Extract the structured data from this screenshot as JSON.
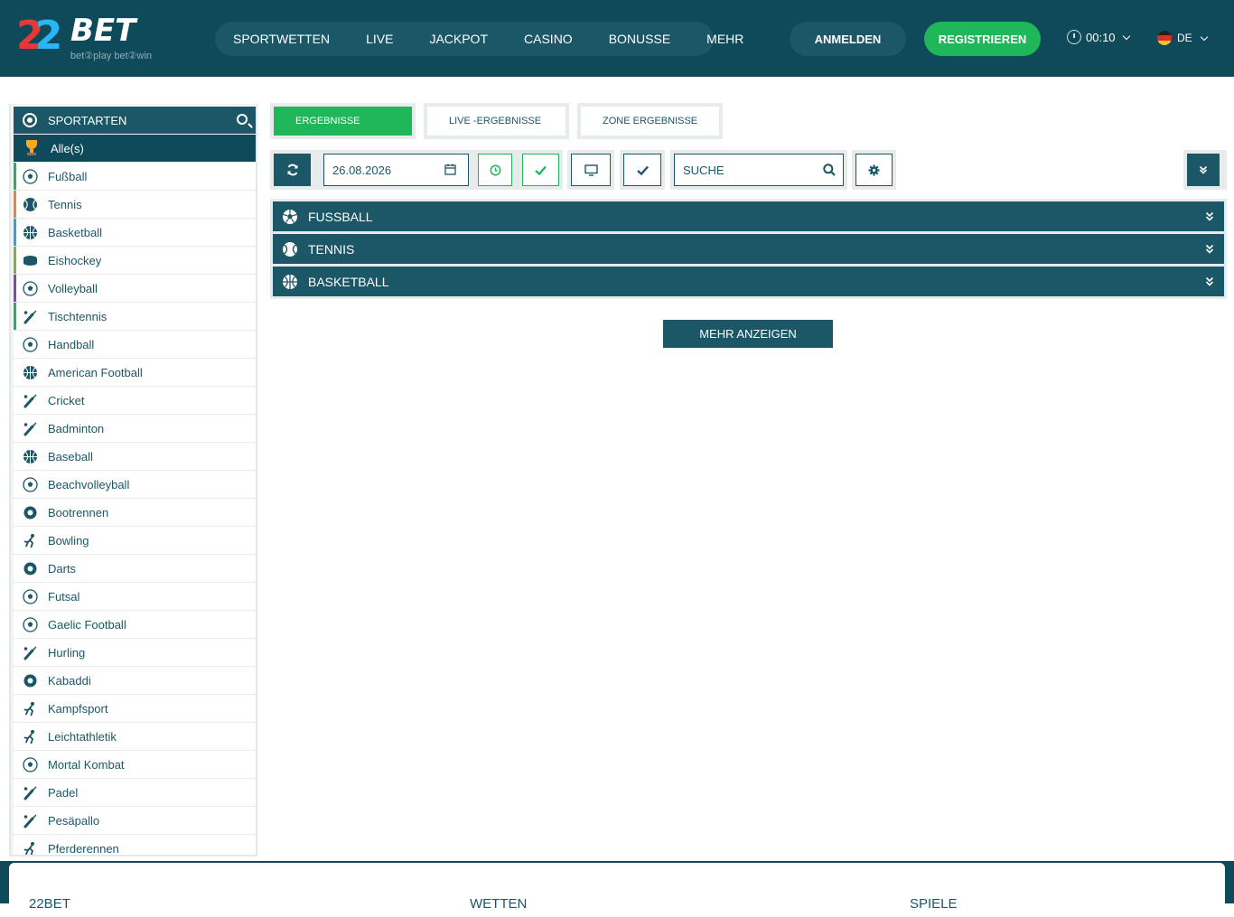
{
  "logo": {
    "brand_digits": "22",
    "brand_text": "BET",
    "tagline": "bet②play  bet②win"
  },
  "nav": {
    "items": [
      "SPORTWETTEN",
      "LIVE",
      "JACKPOT",
      "CASINO",
      "BONUSSE",
      "MEHR"
    ]
  },
  "header": {
    "login_label": "ANMELDEN",
    "register_label": "REGISTRIEREN",
    "time": "00:10",
    "language": "DE"
  },
  "sidebar": {
    "title": "SPORTARTEN",
    "all_label": "Alle(s)",
    "items": [
      {
        "label": "Fußball",
        "stripe": "#1fb759",
        "icon": "soccer-ball-icon"
      },
      {
        "label": "Tennis",
        "stripe": "#f0803c",
        "icon": "tennis-ball-icon"
      },
      {
        "label": "Basketball",
        "stripe": "#29a7d8",
        "icon": "basketball-icon"
      },
      {
        "label": "Eishockey",
        "stripe": "#7cb342",
        "icon": "hockey-puck-icon"
      },
      {
        "label": "Volleyball",
        "stripe": "#8e44ad",
        "icon": "volleyball-icon"
      },
      {
        "label": "Tischtennis",
        "stripe": "#1fb759",
        "icon": "table-tennis-icon"
      },
      {
        "label": "Handball",
        "stripe": "",
        "icon": "handball-icon"
      },
      {
        "label": "American Football",
        "stripe": "",
        "icon": "american-football-icon"
      },
      {
        "label": "Cricket",
        "stripe": "",
        "icon": "cricket-bat-icon"
      },
      {
        "label": "Badminton",
        "stripe": "",
        "icon": "shuttlecock-icon"
      },
      {
        "label": "Baseball",
        "stripe": "",
        "icon": "baseball-icon"
      },
      {
        "label": "Beachvolleyball",
        "stripe": "",
        "icon": "beach-volleyball-icon"
      },
      {
        "label": "Bootrennen",
        "stripe": "",
        "icon": "boat-icon"
      },
      {
        "label": "Bowling",
        "stripe": "",
        "icon": "bowling-icon"
      },
      {
        "label": "Darts",
        "stripe": "",
        "icon": "dartboard-icon"
      },
      {
        "label": "Futsal",
        "stripe": "",
        "icon": "futsal-ball-icon"
      },
      {
        "label": "Gaelic Football",
        "stripe": "",
        "icon": "gaelic-football-icon"
      },
      {
        "label": "Hurling",
        "stripe": "",
        "icon": "hurling-sticks-icon"
      },
      {
        "label": "Kabaddi",
        "stripe": "",
        "icon": "kabaddi-court-icon"
      },
      {
        "label": "Kampfsport",
        "stripe": "",
        "icon": "martial-arts-icon"
      },
      {
        "label": "Leichtathletik",
        "stripe": "",
        "icon": "runner-icon"
      },
      {
        "label": "Mortal Kombat",
        "stripe": "",
        "icon": "mortal-kombat-icon"
      },
      {
        "label": "Padel",
        "stripe": "",
        "icon": "padel-racket-icon"
      },
      {
        "label": "Pesäpallo",
        "stripe": "",
        "icon": "pesapallo-bat-icon"
      },
      {
        "label": "Pferderennen",
        "stripe": "",
        "icon": "horse-racing-icon"
      }
    ]
  },
  "tabs": [
    "ERGEBNISSE",
    "LIVE -ERGEBNISSE",
    "ZONE ERGEBNISSE"
  ],
  "toolbar": {
    "date": "26.08.2026",
    "search_placeholder": "SUCHE"
  },
  "results": [
    {
      "label": "FUSSBALL",
      "icon": "soccer-ball-icon"
    },
    {
      "label": "TENNIS",
      "icon": "tennis-ball-icon"
    },
    {
      "label": "BASKETBALL",
      "icon": "basketball-icon"
    }
  ],
  "more_label": "MEHR ANZEIGEN",
  "footer": {
    "columns": [
      "22BET",
      "WETTEN",
      "SPIELE"
    ]
  },
  "colors": {
    "primary": "#1b5766",
    "header_bg": "#0f4a5a",
    "accent_green": "#1fb759"
  }
}
